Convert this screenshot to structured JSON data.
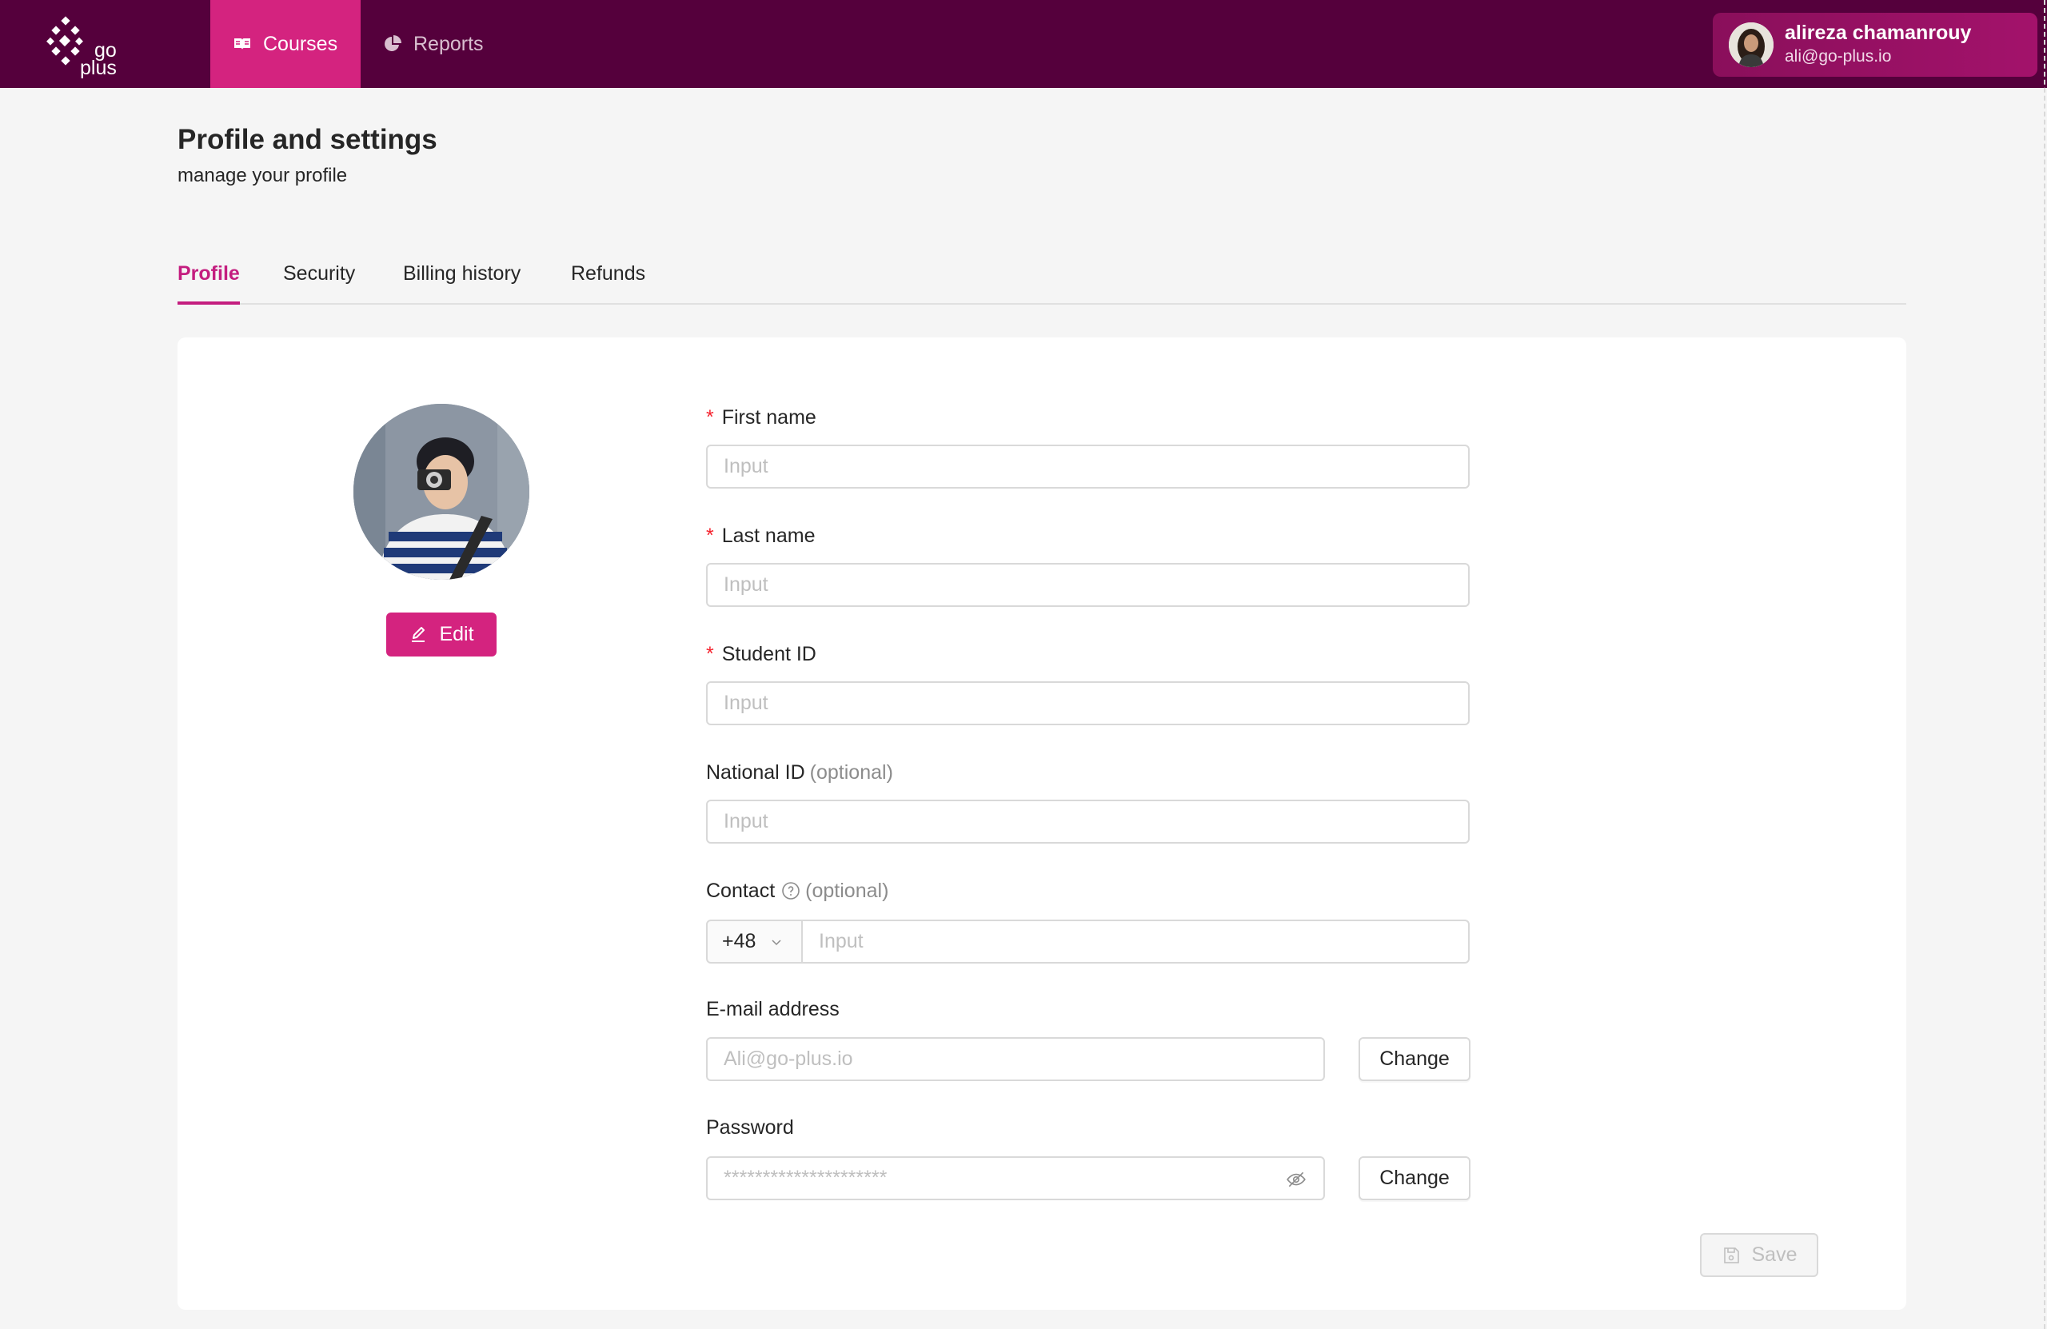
{
  "nav": {
    "logo": {
      "line1": "go",
      "line2": "plus"
    },
    "items": [
      {
        "label": "Courses",
        "icon": "book-icon",
        "active": true
      },
      {
        "label": "Reports",
        "icon": "pie-chart-icon",
        "active": false
      }
    ],
    "user": {
      "name": "alireza chamanrouy",
      "email": "ali@go-plus.io"
    }
  },
  "header": {
    "title": "Profile and settings",
    "subtitle": "manage your profile"
  },
  "tabs": [
    {
      "label": "Profile",
      "active": true
    },
    {
      "label": "Security",
      "active": false
    },
    {
      "label": "Billing history",
      "active": false
    },
    {
      "label": "Refunds",
      "active": false
    }
  ],
  "profile": {
    "edit_label": "Edit",
    "fields": {
      "first_name": {
        "label": "First name",
        "required": "*",
        "placeholder": "Input"
      },
      "last_name": {
        "label": "Last name",
        "required": "*",
        "placeholder": "Input"
      },
      "student_id": {
        "label": "Student ID",
        "required": "*",
        "placeholder": "Input"
      },
      "national_id": {
        "label": "National ID",
        "optional": "(optional)",
        "placeholder": "Input"
      },
      "contact": {
        "label": "Contact",
        "optional": "(optional)",
        "prefix": "+48",
        "placeholder": "Input"
      },
      "email": {
        "label": "E-mail address",
        "placeholder": "Ali@go-plus.io",
        "change_label": "Change"
      },
      "password": {
        "label": "Password",
        "placeholder": "*********************",
        "change_label": "Change"
      }
    },
    "save_label": "Save"
  },
  "colors": {
    "nav_bg": "#55003c",
    "accent": "#d4237f",
    "active_tab": "#c41d7f"
  }
}
